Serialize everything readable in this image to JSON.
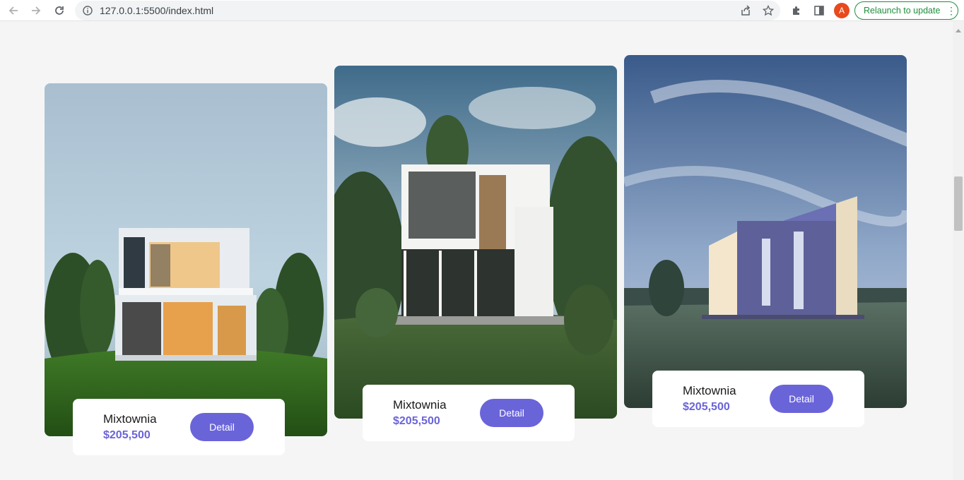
{
  "browser": {
    "url": "127.0.0.1:5500/index.html",
    "avatar_letter": "A",
    "relaunch_label": "Relaunch to update"
  },
  "listings": [
    {
      "name": "Mixtownia",
      "price": "$205,500",
      "button": "Detail"
    },
    {
      "name": "Mixtownia",
      "price": "$205,500",
      "button": "Detail"
    },
    {
      "name": "Mixtownia",
      "price": "$205,500",
      "button": "Detail"
    }
  ],
  "colors": {
    "accent": "#6a64d9",
    "page_bg": "#f5f5f5",
    "relaunch_green": "#1e8e3e"
  }
}
